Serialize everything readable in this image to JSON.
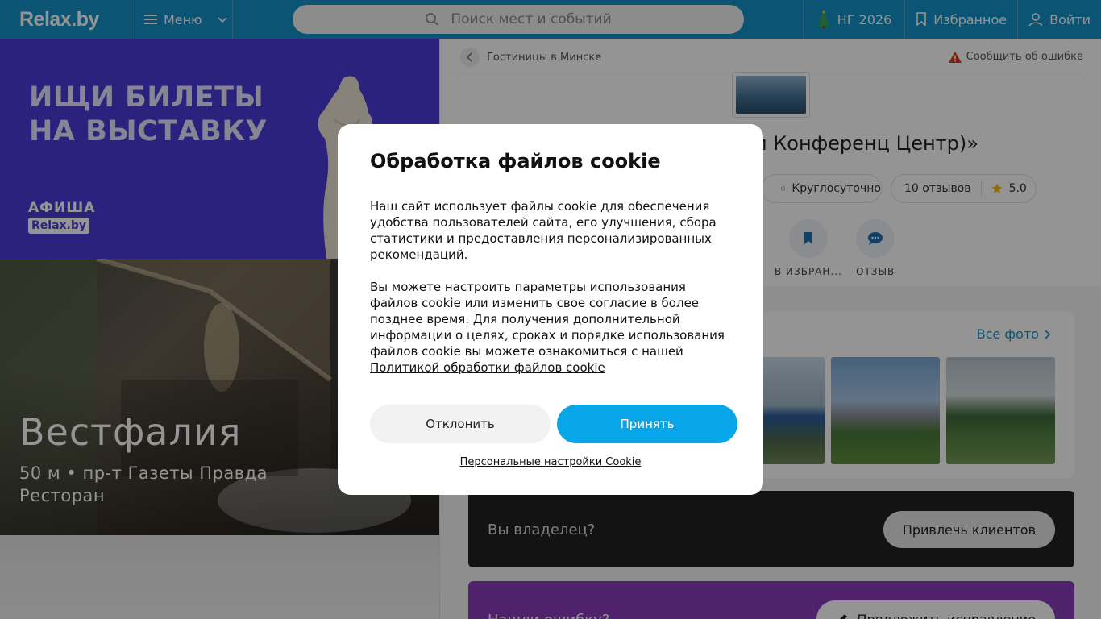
{
  "header": {
    "logo": "Relax.by",
    "menu_label": "Меню",
    "search_placeholder": "Поиск мест и событий",
    "ng_label": "НГ 2026",
    "favorites_label": "Избранное",
    "login_label": "Войти"
  },
  "banner": {
    "line1": "ИЩИ БИЛЕТЫ",
    "line2": "НА ВЫСТАВКУ",
    "brand_top": "АФИША",
    "brand_bottom": "Relax.by"
  },
  "promo": {
    "title": "Вестфалия",
    "subtitle": "50 м • пр-т Газеты Правда",
    "category": "Ресторан"
  },
  "page": {
    "breadcrumb": "Гостиницы в Минске",
    "report_error": "Сообщить об ошибке",
    "title_partial": "и Конференц Центр)»",
    "hours": "Круглосуточно",
    "reviews": "10 отзывов",
    "rating": "5.0",
    "action_favorite": "В ИЗБРАН...",
    "action_review": "ОТЗЫВ",
    "all_photos": "Все фото",
    "owner_text": "Вы владелец?",
    "owner_button": "Привлечь клиентов",
    "found_text": "Нашли ошибку?",
    "found_button": "Предложить исправление"
  },
  "cookie": {
    "title": "Обработка файлов cookie",
    "para1": "Наш сайт использует файлы cookie для обеспечения удобства пользователей сайта, его улучшения, сбора статистики и предоставления персонализированных рекомендаций.",
    "para2": "Вы можете настроить параметры использования файлов cookie или изменить свое согласие в более позднее время. Для получения дополнительной информации о целях, сроках и порядке использования файлов cookie вы можете ознакомиться с нашей",
    "policy_link": "Политикой обработки файлов cookie",
    "decline": "Отклонить",
    "accept": "Принять",
    "personal_settings": "Персональные настройки Cookie"
  },
  "colors": {
    "header": "#1392c9",
    "banner": "#4a3cd9",
    "accept": "#07a6e8",
    "found": "#8a3bb8"
  }
}
